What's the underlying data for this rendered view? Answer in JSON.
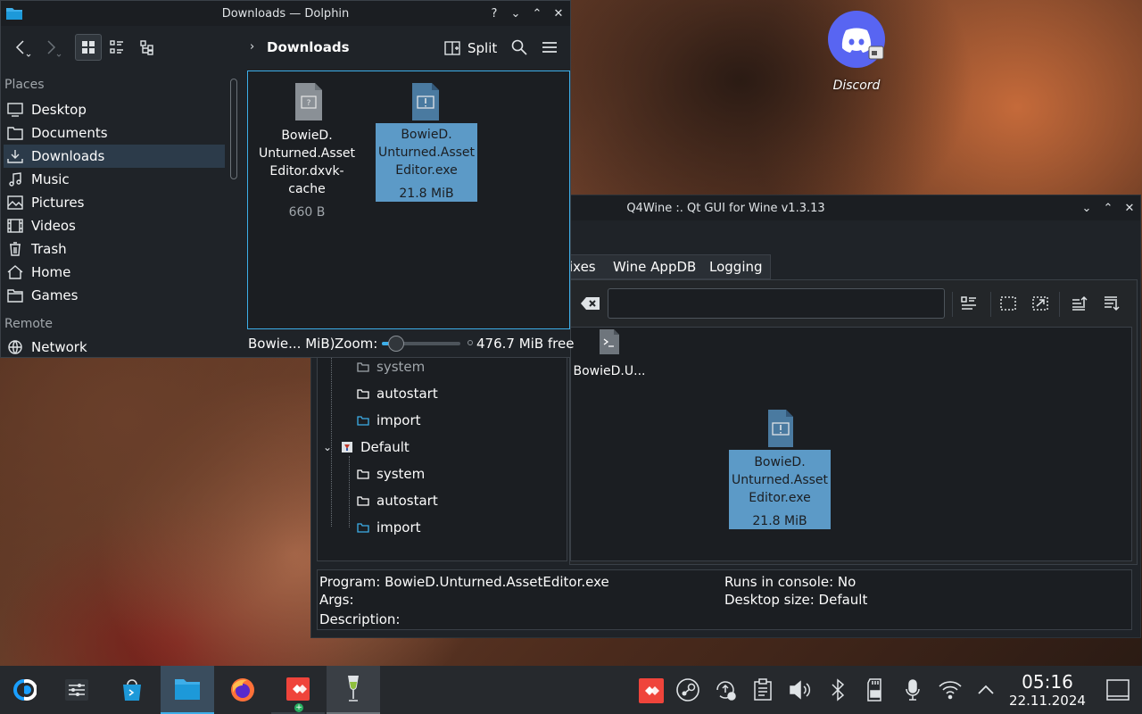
{
  "desktop": {
    "discord_label": "Discord"
  },
  "dolphin": {
    "title": "Downloads — Dolphin",
    "toolbar": {
      "split_label": "Split",
      "breadcrumb": "Downloads"
    },
    "sidebar": {
      "places_header": "Places",
      "places": [
        {
          "label": "Desktop"
        },
        {
          "label": "Documents"
        },
        {
          "label": "Downloads"
        },
        {
          "label": "Music"
        },
        {
          "label": "Pictures"
        },
        {
          "label": "Videos"
        },
        {
          "label": "Trash"
        },
        {
          "label": "Home"
        },
        {
          "label": "Games"
        }
      ],
      "remote_header": "Remote",
      "remote": [
        {
          "label": "Network"
        }
      ]
    },
    "files": [
      {
        "name_lines": [
          "BowieD.",
          "Unturned.Asset",
          "Editor.dxvk-cache"
        ],
        "size": "660 B"
      },
      {
        "name_lines": [
          "BowieD.",
          "Unturned.Asset",
          "Editor.exe"
        ],
        "size": "21.8 MiB"
      }
    ],
    "status": {
      "selection": "Bowie... MiB)",
      "zoom_label": "Zoom:",
      "zoom_level": 0.18,
      "free_space": "476.7 MiB free"
    }
  },
  "q4wine": {
    "title": "Q4Wine :. Qt GUI for Wine v1.3.13",
    "tabs": [
      "ixes",
      "Wine AppDB",
      "Logging"
    ],
    "search": {
      "value": ""
    },
    "tree": [
      {
        "label": "system",
        "kind": "folder"
      },
      {
        "label": "autostart",
        "kind": "folder"
      },
      {
        "label": "import",
        "kind": "import"
      },
      {
        "label": "Default",
        "kind": "prefix"
      },
      {
        "label": "system",
        "kind": "folder"
      },
      {
        "label": "autostart",
        "kind": "folder"
      },
      {
        "label": "import",
        "kind": "import"
      }
    ],
    "icons": [
      {
        "label": "BowieD.U..."
      },
      {
        "name_lines": [
          "BowieD.",
          "Unturned.Asset",
          "Editor.exe"
        ],
        "size": "21.8 MiB"
      }
    ],
    "info": {
      "program": "Program: BowieD.Unturned.AssetEditor.exe",
      "args": "Args:",
      "description": "Description:",
      "console": "Runs in console: No",
      "desktop_size": "Desktop size: Default"
    }
  },
  "taskbar": {
    "time": "05:16",
    "date": "22.11.2024"
  },
  "colors": {
    "accent": "#3daee9",
    "selection": "#5c9ac7",
    "panel": "#1f2328",
    "anydesk": "#ef443b",
    "discord": "#5865f2"
  }
}
